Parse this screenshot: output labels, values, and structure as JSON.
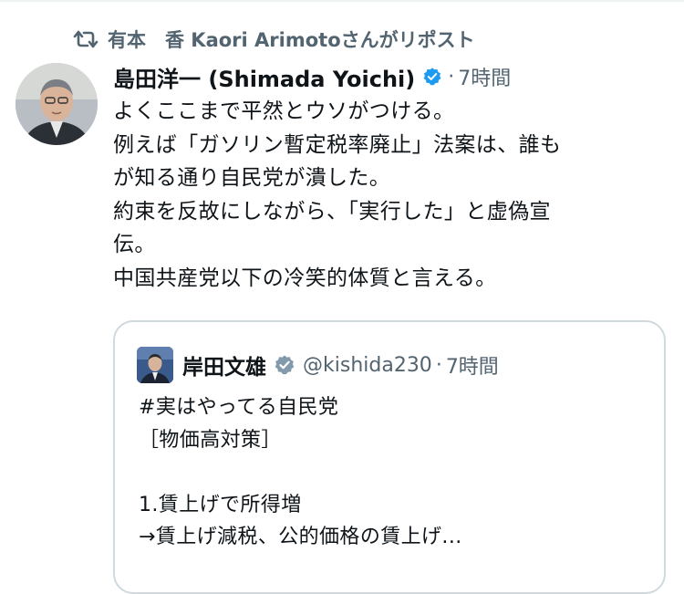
{
  "repost": {
    "text": "有本　香  Kaori Arimotoさんがリポスト",
    "icon": "repost-icon"
  },
  "tweet": {
    "author_name": "島田洋一 (Shimada Yoichi)",
    "verified_icon": "verified-badge-icon",
    "separator": "·",
    "time": "7時間",
    "body_lines": [
      "よくここまで平然とウソがつける。",
      "例えば「ガソリン暫定税率廃止」法案は、誰も",
      "が知る通り自民党が潰した。",
      "約束を反故にしながら、「実行した」と虚偽宣",
      "伝。",
      "中国共産党以下の冷笑的体質と言える。"
    ]
  },
  "quote": {
    "author_name": "岸田文雄",
    "verified_icon": "gray-verified-badge-icon",
    "handle": "@kishida230",
    "separator": "·",
    "time": "7時間",
    "body_lines": [
      "#実はやってる自民党",
      "［物価高対策］",
      "",
      "1.賃上げで所得増",
      "→賃上げ減税、公的価格の賃上げ..."
    ]
  },
  "colors": {
    "text_primary": "#0f1419",
    "text_secondary": "#536471",
    "verified_blue": "#1d9bf0",
    "verified_gray": "#829aab",
    "card_border": "#cfd9de"
  }
}
